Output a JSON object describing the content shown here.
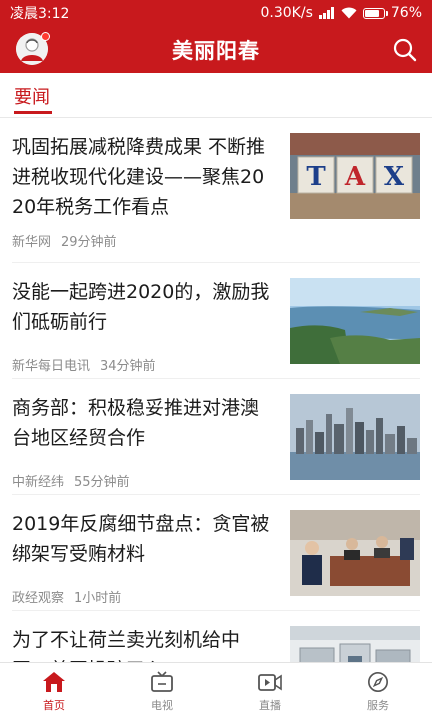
{
  "status_bar": {
    "time": "凌晨3:12",
    "network_speed": "0.30K/s",
    "battery": "76%"
  },
  "header": {
    "title": "美丽阳春",
    "avatar_icon": "user-avatar-icon",
    "search_icon": "search-icon"
  },
  "tabs": {
    "active_label": "要闻"
  },
  "news": [
    {
      "title": "巩固拓展减税降费成果 不断推进税收现代化建设——聚焦2020年税务工作看点",
      "source": "新华网",
      "time": "29分钟前",
      "thumb": "tax-blocks-image"
    },
    {
      "title": "没能一起跨进2020的，激励我们砥砺前行",
      "source": "新华每日电讯",
      "time": "34分钟前",
      "thumb": "river-landscape-image"
    },
    {
      "title": "商务部：积极稳妥推进对港澳台地区经贸合作",
      "source": "中新经纬",
      "time": "55分钟前",
      "thumb": "city-skyline-image"
    },
    {
      "title": "2019年反腐细节盘点：贪官被绑架写受贿材料",
      "source": "政经观察",
      "time": "1小时前",
      "thumb": "courtroom-image"
    },
    {
      "title": "为了不让荷兰卖光刻机给中国，美国操碎了心",
      "source": "",
      "time": "",
      "thumb": "factory-machine-image"
    }
  ],
  "bottom_nav": [
    {
      "label": "首页",
      "icon": "home-icon",
      "active": true
    },
    {
      "label": "电视",
      "icon": "tv-icon",
      "active": false
    },
    {
      "label": "直播",
      "icon": "live-video-icon",
      "active": false
    },
    {
      "label": "服务",
      "icon": "compass-icon",
      "active": false
    }
  ],
  "colors": {
    "brand_red": "#c8191d",
    "meta_gray": "#8c8c8c"
  }
}
